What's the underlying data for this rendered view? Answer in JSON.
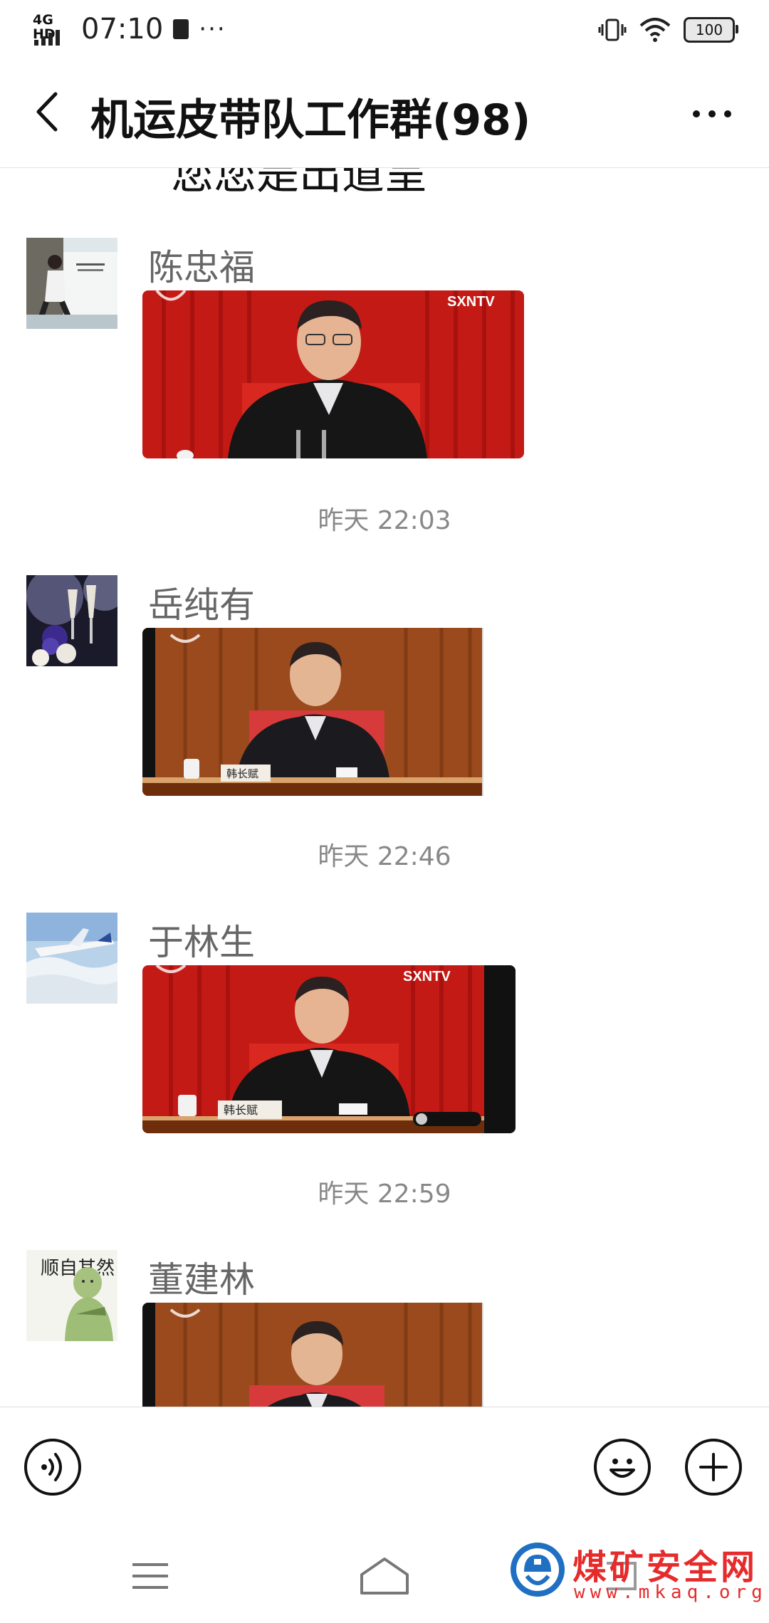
{
  "status_bar": {
    "network": "4G HD",
    "time": "07:10",
    "more": "···",
    "battery": "100"
  },
  "header": {
    "title": "机运皮带队工作群(98)"
  },
  "partial_message": "您您是出道呈",
  "messages": [
    {
      "sender": "陈忠福",
      "timestamp_after": "昨天 22:03",
      "channel": "SXNTV",
      "caption": ""
    },
    {
      "sender": "岳纯有",
      "timestamp_after": "昨天 22:46",
      "channel": "",
      "caption": "韩长赋"
    },
    {
      "sender": "于林生",
      "timestamp_after": "昨天 22:59",
      "channel": "SXNTV",
      "caption": "韩长赋"
    },
    {
      "sender": "董建林",
      "timestamp_after": "",
      "channel": "",
      "caption": ""
    }
  ],
  "avatar_text": "顺自其然",
  "watermark": {
    "name": "煤矿安全网",
    "url": "www.mkaq.org"
  },
  "colors": {
    "curtain_red": "#c41a16",
    "curtain_wood": "#9a4a1c",
    "watermark_red": "#e52b2b",
    "watermark_blue": "#1f6fc2"
  }
}
